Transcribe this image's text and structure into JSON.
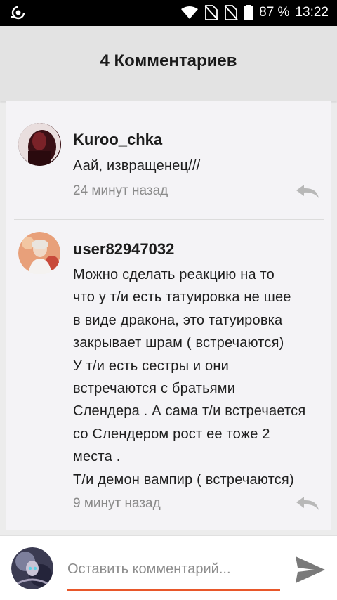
{
  "statusbar": {
    "battery": "87 %",
    "time": "13:22"
  },
  "header": {
    "title": "4 Комментариев"
  },
  "comments": [
    {
      "username": "Kuroo_chka",
      "text": "Аай, извращенец///",
      "time": "24 минут назад"
    },
    {
      "username": "user82947032",
      "text": "Можно сделать реакцию на то\nчто у т/и есть татуировка не шее\nв виде дракона, это татуировка\nзакрывает шрам ( встречаются)\nУ т/и есть сестры и они\nвстречаются с братьями\nСлендера . А сама т/и встречается\nсо Слендером рост ее тоже 2\nместа .\nТ/и демон вампир ( встречаются)",
      "time": "9 минут назад"
    }
  ],
  "composer": {
    "placeholder": "Оставить комментарий..."
  },
  "colors": {
    "accent": "#e8572a",
    "header_bg": "#e3e3e3",
    "list_bg": "#f4f3f6"
  }
}
